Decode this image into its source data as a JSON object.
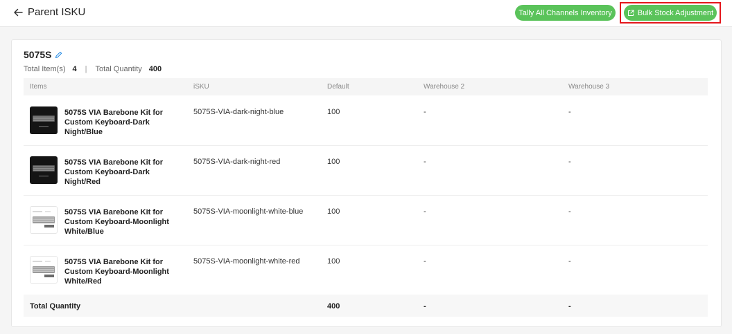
{
  "header": {
    "title": "Parent ISKU",
    "tally_button": "Tally All Channels Inventory",
    "bulk_button": "Bulk Stock Adjustment"
  },
  "card": {
    "title": "5075S",
    "total_items_label": "Total Item(s)",
    "total_items_value": "4",
    "separator": "|",
    "total_quantity_label": "Total Quantity",
    "total_quantity_value": "400"
  },
  "table": {
    "columns": [
      "Items",
      "iSKU",
      "Default",
      "Warehouse 2",
      "Warehouse 3"
    ],
    "rows": [
      {
        "name": "5075S VIA Barebone Kit for Custom Keyboard-Dark Night/Blue",
        "isku": "5075S-VIA-dark-night-blue",
        "default": "100",
        "warehouse2": "-",
        "warehouse3": "-",
        "thumb": "dark"
      },
      {
        "name": "5075S VIA Barebone Kit for Custom Keyboard-Dark Night/Red",
        "isku": "5075S-VIA-dark-night-red",
        "default": "100",
        "warehouse2": "-",
        "warehouse3": "-",
        "thumb": "dark"
      },
      {
        "name": "5075S VIA Barebone Kit for Custom Keyboard-Moonlight White/Blue",
        "isku": "5075S-VIA-moonlight-white-blue",
        "default": "100",
        "warehouse2": "-",
        "warehouse3": "-",
        "thumb": "light"
      },
      {
        "name": "5075S VIA Barebone Kit for Custom Keyboard-Moonlight White/Red",
        "isku": "5075S-VIA-moonlight-white-red",
        "default": "100",
        "warehouse2": "-",
        "warehouse3": "-",
        "thumb": "light"
      }
    ],
    "total": {
      "label": "Total Quantity",
      "default": "400",
      "warehouse2": "-",
      "warehouse3": "-"
    }
  },
  "icons": {
    "back": "arrow-left-icon",
    "edit": "pencil-icon",
    "external": "external-link-icon"
  },
  "colors": {
    "accent": "#5ac35a",
    "highlight": "#e4161b",
    "link": "#1e88e5"
  }
}
